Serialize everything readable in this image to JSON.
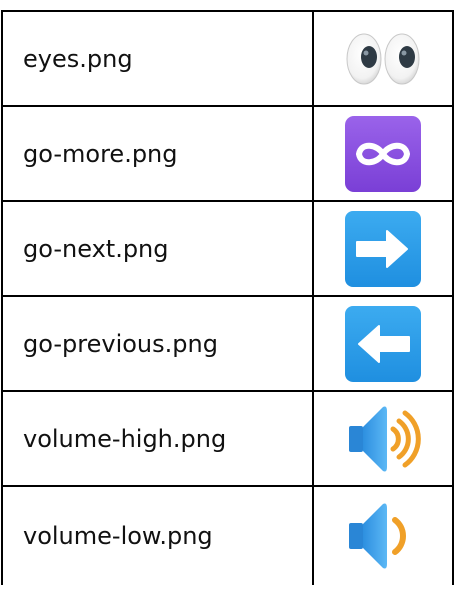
{
  "rows": [
    {
      "filename": "eyes.png",
      "icon": "eyes-icon"
    },
    {
      "filename": "go-more.png",
      "icon": "infinity-icon"
    },
    {
      "filename": "go-next.png",
      "icon": "right-arrow-icon"
    },
    {
      "filename": "go-previous.png",
      "icon": "left-arrow-icon"
    },
    {
      "filename": "volume-high.png",
      "icon": "speaker-high-volume-icon"
    },
    {
      "filename": "volume-low.png",
      "icon": "speaker-low-volume-icon"
    }
  ],
  "colors": {
    "border": "#000000",
    "text": "#111111",
    "infinity_bg": "#8b4fe0",
    "arrow_bg": "#2a9be8",
    "speaker_blue": "#3aa3ee",
    "speaker_orange": "#f0a028"
  }
}
